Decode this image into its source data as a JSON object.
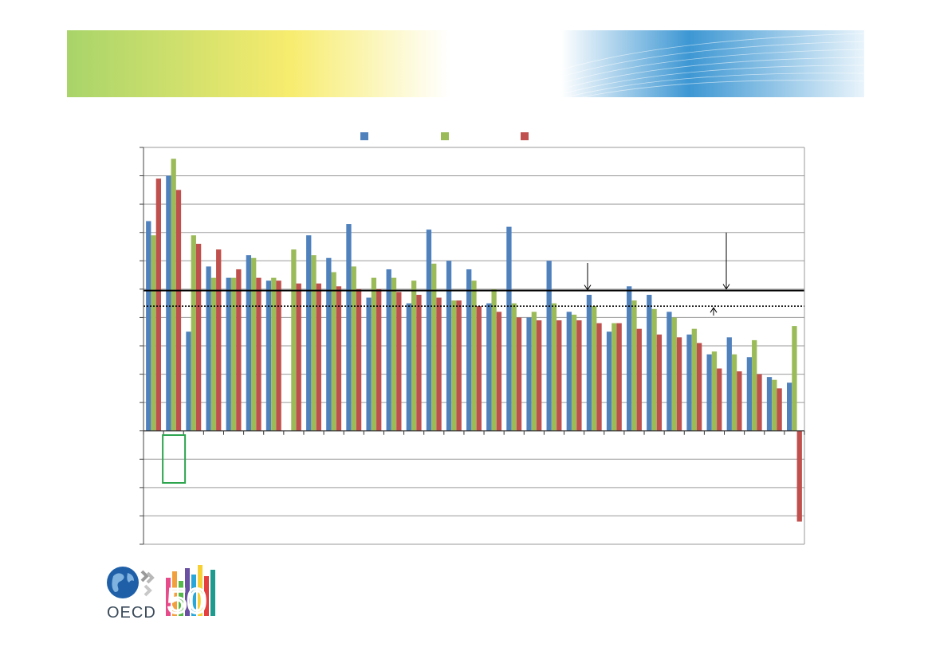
{
  "chart_data": {
    "type": "bar",
    "title": "",
    "xlabel": "",
    "ylabel": "",
    "ylim": [
      -4,
      10
    ],
    "grid": true,
    "legend_position": "top-center",
    "series": [
      {
        "color": "#4f81bd",
        "values": [
          7.4,
          9.0,
          3.5,
          5.8,
          5.4,
          6.2,
          5.3,
          null,
          6.9,
          6.1,
          7.3,
          4.7,
          5.7,
          4.5,
          7.1,
          6.0,
          5.7,
          4.5,
          7.2,
          4.0,
          6.0,
          4.2,
          4.8,
          3.5,
          5.1,
          4.8,
          4.2,
          3.4,
          2.7,
          3.3,
          2.6,
          1.9,
          1.7
        ]
      },
      {
        "color": "#9bbb59",
        "values": [
          6.9,
          9.6,
          6.9,
          5.4,
          5.4,
          6.1,
          5.4,
          6.4,
          6.2,
          5.6,
          5.8,
          5.4,
          5.4,
          5.3,
          5.9,
          4.6,
          5.3,
          5.0,
          4.5,
          4.2,
          4.5,
          4.1,
          4.4,
          3.8,
          4.6,
          4.3,
          4.0,
          3.6,
          2.8,
          2.7,
          3.2,
          1.8,
          3.7
        ]
      },
      {
        "color": "#c0504d",
        "values": [
          8.9,
          8.5,
          6.6,
          6.4,
          5.7,
          5.4,
          5.3,
          5.2,
          5.2,
          5.1,
          5.0,
          5.0,
          4.9,
          4.8,
          4.7,
          4.6,
          4.4,
          4.2,
          4.0,
          3.9,
          3.9,
          3.9,
          3.8,
          3.8,
          3.6,
          3.4,
          3.3,
          3.1,
          2.2,
          2.1,
          2.0,
          1.5,
          -3.2
        ]
      }
    ],
    "reference_lines": [
      {
        "value": 4.95,
        "style": "solid"
      },
      {
        "value": 4.4,
        "style": "dotted"
      }
    ],
    "highlight_group_index": 1
  }
}
